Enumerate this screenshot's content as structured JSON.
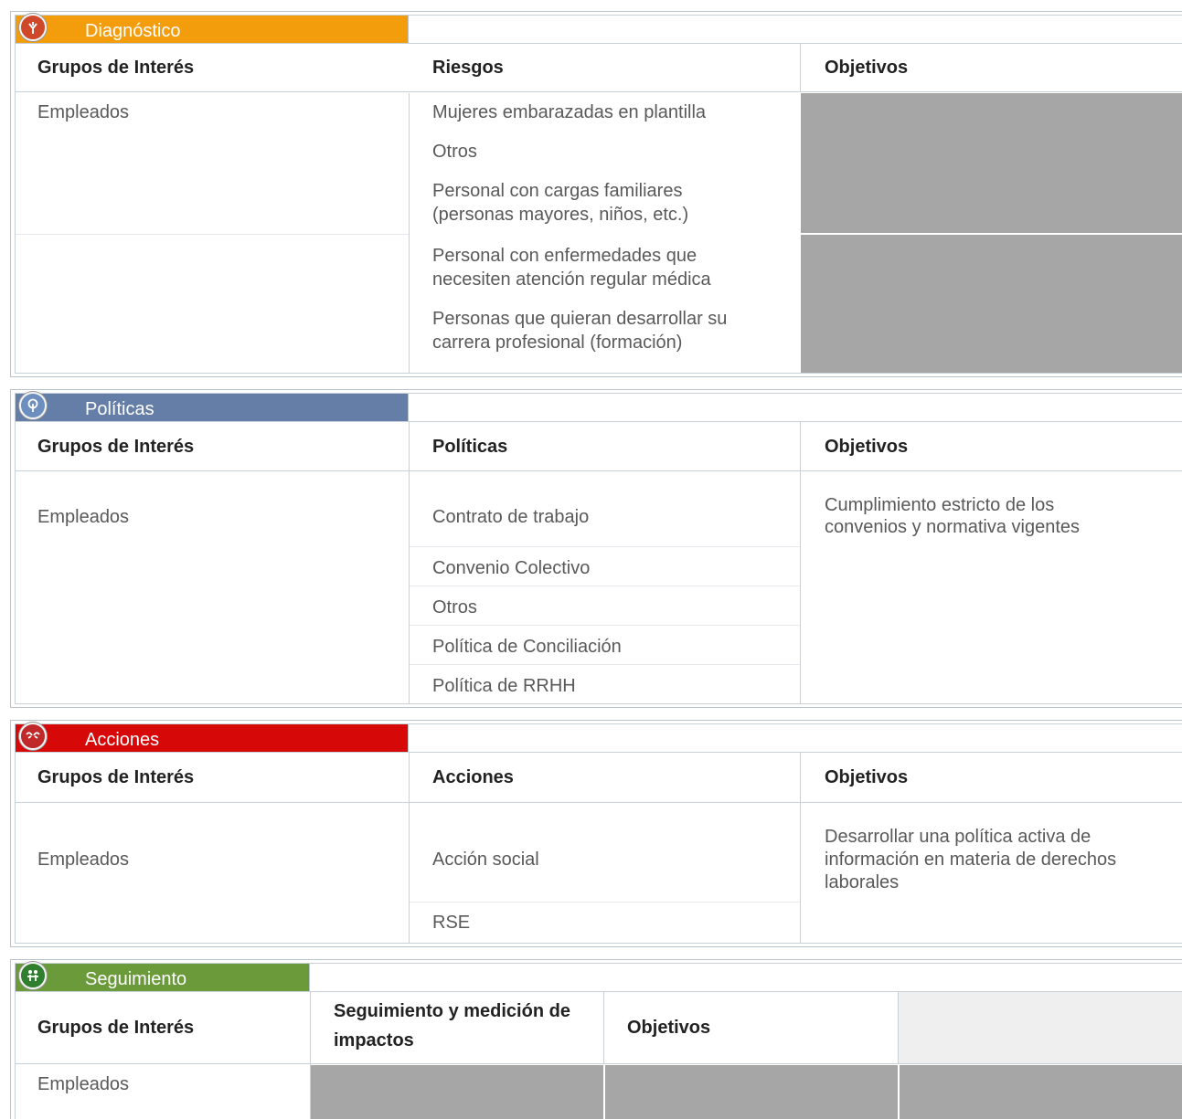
{
  "diagnostico": {
    "title": "Diagnóstico",
    "color": "#f39c0c",
    "icon": "tree-icon",
    "headers": [
      "Grupos de Interés",
      "Riesgos",
      "Objetivos"
    ],
    "group": "Empleados",
    "items": [
      "Mujeres embarazadas en plantilla",
      "Otros",
      "Personal con cargas familiares (personas mayores, niños, etc.)",
      "Personal con enfermedades que necesiten atención regular médica",
      "Personas que quieran desarrollar su carrera profesional (formación)"
    ]
  },
  "politicas": {
    "title": "Políticas",
    "color": "#647ea8",
    "icon": "tree-icon",
    "headers": [
      "Grupos de Interés",
      "Políticas",
      "Objetivos"
    ],
    "group": "Empleados",
    "items": [
      "Contrato de trabajo",
      "Convenio Colectivo",
      "Otros",
      "Política de Conciliación",
      "Política de RRHH"
    ],
    "objective": "Cumplimiento estricto de los convenios y normativa vigentes"
  },
  "acciones": {
    "title": "Acciones",
    "color": "#d60808",
    "icon": "hands-icon",
    "headers": [
      "Grupos de Interés",
      "Acciones",
      "Objetivos"
    ],
    "group": "Empleados",
    "items": [
      "Acción social",
      "RSE"
    ],
    "objective": "Desarrollar una política activa de información en materia de derechos laborales"
  },
  "seguimiento": {
    "title": "Seguimiento",
    "color": "#6a9a3a",
    "icon": "people-icon",
    "headers": [
      "Grupos de Interés",
      "Seguimiento y medición de impactos",
      "Objetivos"
    ],
    "group": "Empleados"
  },
  "colors": {
    "border": "#c8d0d8",
    "gray_cell": "#a6a6a6",
    "light_cell": "#efefef"
  }
}
